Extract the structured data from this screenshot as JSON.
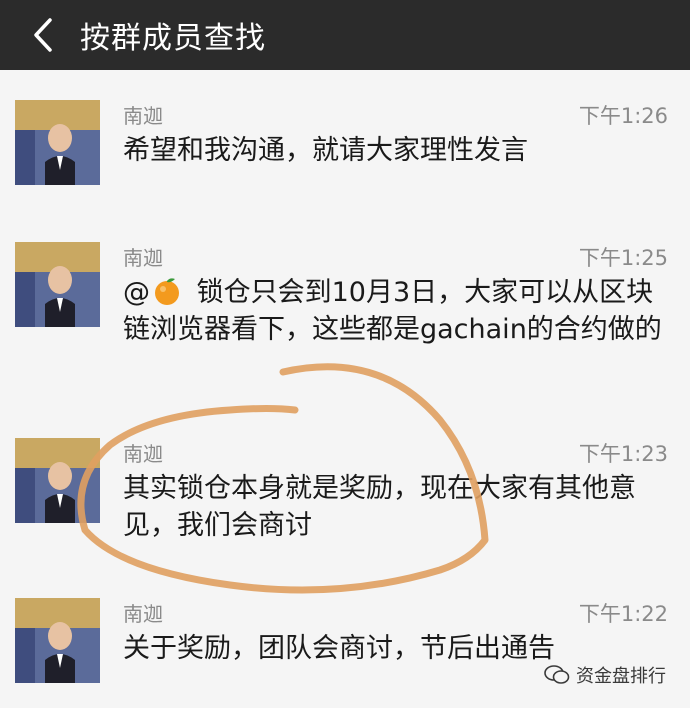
{
  "header": {
    "title": "按群成员查找"
  },
  "messages": [
    {
      "sender": "南迦",
      "time": "下午1:26",
      "text": "希望和我沟通，就请大家理性发言"
    },
    {
      "sender": "南迦",
      "time": "下午1:25",
      "mention": "@",
      "text": " 锁仓只会到10月3日，大家可以从区块链浏览器看下，这些都是gachain的合约做的"
    },
    {
      "sender": "南迦",
      "time": "下午1:23",
      "text": "其实锁仓本身就是奖励，现在大家有其他意见，我们会商讨"
    },
    {
      "sender": "南迦",
      "time": "下午1:22",
      "text": "关于奖励，团队会商讨，节后出通告"
    }
  ],
  "watermark": {
    "text": "资金盘排行"
  },
  "colors": {
    "topbar": "#2b2b2b",
    "background": "#f5f5f5",
    "annotation": "#e0a060"
  },
  "icons": [
    "back-chevron-icon",
    "orange-emoji-icon",
    "wechat-icon"
  ]
}
